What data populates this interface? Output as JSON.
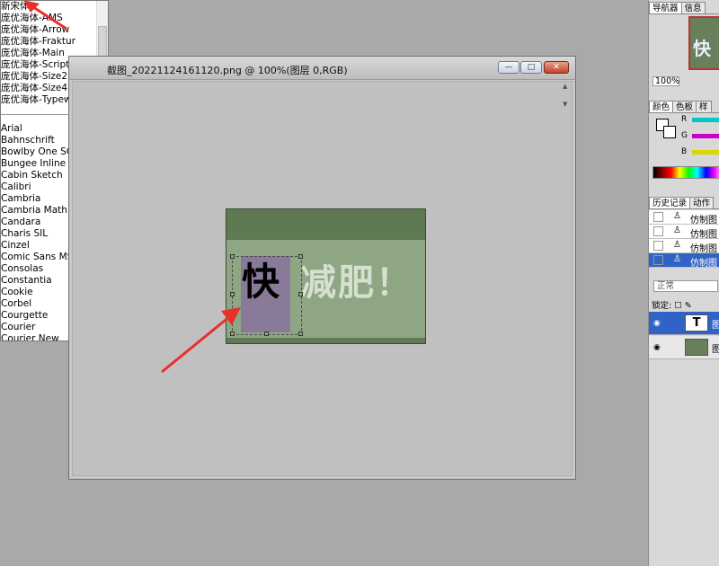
{
  "font_list": {
    "items_top": [
      "新宋体",
      "庞优海体-AMS",
      "庞优海体-Arrow",
      "庞优海体-Fraktur",
      "庞优海体-Main",
      "庞优海体-Script",
      "庞优海体-Size2",
      "庞优海体-Size4",
      "庞优海体-Typewriter"
    ],
    "items_bottom": [
      "Arial",
      "Bahnschrift",
      "Bowlby One SC",
      "Bungee Inline",
      "Cabin Sketch",
      "Calibri",
      "Cambria",
      "Cambria Math",
      "Candara",
      "Charis SIL",
      "Cinzel",
      "Comic Sans MS",
      "Consolas",
      "Constantia",
      "Cookie",
      "Corbel",
      "Courgette",
      "Courier",
      "Courier New"
    ]
  },
  "document": {
    "title": "截图_20221124161120.png @ 100%(图层 0,RGB)",
    "controls": {
      "minimize": "—",
      "maximize": "□",
      "close": "✕"
    }
  },
  "canvas_image": {
    "big_char": "快",
    "rest_text": "减肥！"
  },
  "panels": {
    "navigator": {
      "tabs": [
        "导航器",
        "信息"
      ],
      "thumb_char": "快",
      "zoom": "100%"
    },
    "color": {
      "tabs": [
        "颜色",
        "色板",
        "样"
      ],
      "channels": [
        {
          "label": "R",
          "color": "#00c8c8"
        },
        {
          "label": "G",
          "color": "#c800c8"
        },
        {
          "label": "B",
          "color": "#d8d800"
        }
      ]
    },
    "history": {
      "tabs": [
        "历史记录",
        "动作"
      ],
      "rows": [
        "仿制图",
        "仿制图",
        "仿制图",
        "仿制图"
      ]
    },
    "layers": {
      "blend_mode": "正常",
      "lock_label": "锁定:",
      "rows": [
        {
          "thumb": "T",
          "name": "图"
        },
        {
          "thumb": "",
          "name": "图"
        }
      ]
    }
  },
  "colors": {
    "selection_blue": "#3162c5",
    "arrow_red": "#e8302a",
    "image_green": "#8ea683"
  }
}
